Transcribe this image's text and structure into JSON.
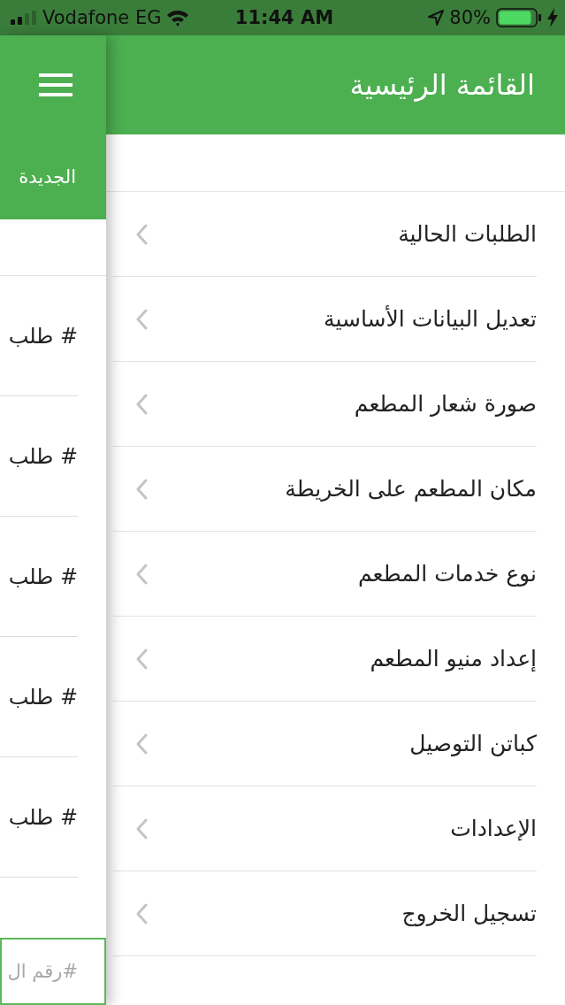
{
  "status_bar": {
    "carrier": "Vodafone EG",
    "time": "11:44 AM",
    "battery": "80%"
  },
  "page": {
    "tabs": [
      {
        "label": "الجديدة"
      }
    ],
    "orders": [
      {
        "label": "# طلب"
      },
      {
        "label": "# طلب"
      },
      {
        "label": "# طلب"
      },
      {
        "label": "# طلب"
      },
      {
        "label": "# طلب"
      }
    ],
    "search": {
      "placeholder": "#رقم ال"
    }
  },
  "side_menu": {
    "title": "القائمة الرئيسية",
    "items": [
      {
        "label": "الطلبات الحالية"
      },
      {
        "label": "تعديل البيانات الأساسية"
      },
      {
        "label": "صورة شعار المطعم"
      },
      {
        "label": "مكان المطعم على الخريطة"
      },
      {
        "label": "نوع خدمات المطعم"
      },
      {
        "label": "إعداد منيو المطعم"
      },
      {
        "label": "كباتن التوصيل"
      },
      {
        "label": "الإعدادات"
      },
      {
        "label": "تسجيل الخروج"
      }
    ]
  }
}
